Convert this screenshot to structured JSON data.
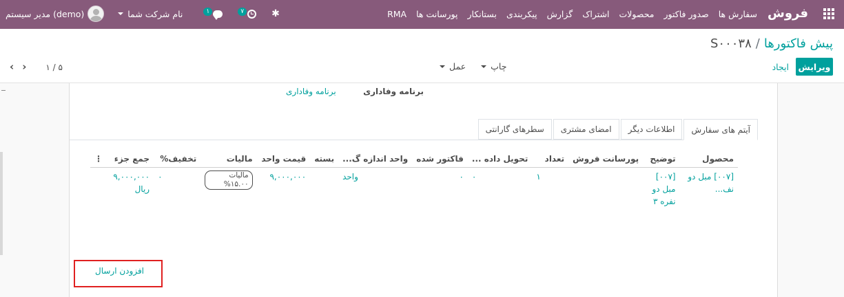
{
  "navbar": {
    "brand": "فروش",
    "menu": [
      "سفارش ها",
      "صدور فاکتور",
      "محصولات",
      "اشتراک",
      "گزارش",
      "پیکربندی",
      "بستانکار",
      "پورسانت ها",
      "RMA"
    ],
    "messages_count": "۱",
    "activities_count": "۷",
    "company": "نام شرکت شما",
    "user": "مدیر سیستم (demo)"
  },
  "breadcrumb": {
    "parent": "پیش فاکتورها",
    "separator": "/",
    "current": "S۰۰۰۳۸"
  },
  "control": {
    "edit_label": "ویرایش",
    "create_label": "ایجاد",
    "print_label": "چاپ",
    "action_label": "عمل",
    "pager_value": "۱ / ۵"
  },
  "form": {
    "loyalty_label": "برنامه وفاداری",
    "loyalty_value": "برنامه وفاداری",
    "tabs": [
      "آیتم های سفارش",
      "اطلاعات دیگر",
      "امضای مشتری",
      "سطرهای گارانتی"
    ],
    "columns": [
      "محصول",
      "توضیح",
      "پورسانت فروش",
      "تعداد",
      "تحویل داده ...",
      "فاکتور شده",
      "واحد اندازه گ...",
      "بسته",
      "قیمت واحد",
      "مالیات",
      "تخفیف%",
      "جمع جزء"
    ],
    "rows": [
      {
        "product": "[۰۰۷] مبل دو نف...",
        "description": "[۰۰۷] مبل دو نفره ۳",
        "commission": "",
        "quantity": "۱",
        "delivered": "۰",
        "invoiced": "۰",
        "uom": "واحد",
        "package": "",
        "unit_price": "۹,۰۰۰,۰۰۰",
        "tax": "مالیات ۱۵.۰۰%",
        "discount": "۰",
        "subtotal": "۹,۰۰۰,۰۰۰ ریال"
      }
    ],
    "add_shipping": "افزودن ارسال"
  }
}
